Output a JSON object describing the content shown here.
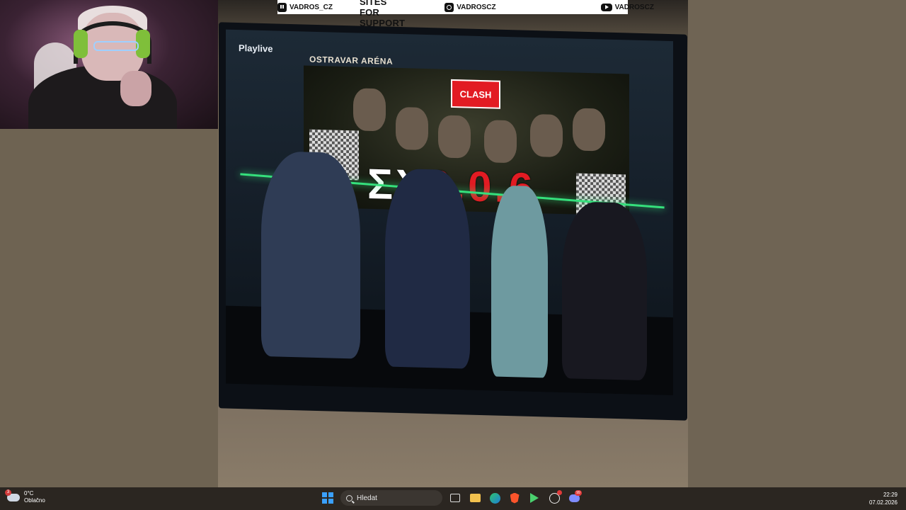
{
  "banner": {
    "twitch_handle": "VADROS_CZ",
    "headline": "SOCIAL SITES FOR SUPPORT",
    "instagram_handle": "VADROSCZ",
    "youtube_handle": "VADROSCZ"
  },
  "tv": {
    "channel_logo": "Playlive",
    "venue": "OSTRAVAR ARÉNA",
    "brand": "CLASH",
    "event_title_prefix": "ƩX",
    "event_title_suffix": "6.0.6"
  },
  "taskbar": {
    "weather_badge": "3",
    "temperature": "0°C",
    "condition": "Oblačno",
    "search_placeholder": "Hledat",
    "time": "22:29",
    "date": "07.02.2026",
    "icons": [
      "windows-start",
      "file-explorer",
      "folder",
      "edge",
      "brave",
      "gamepad",
      "chatgpt",
      "discord"
    ],
    "discord_badge": "99"
  },
  "colors": {
    "accent_red": "#e21b23",
    "neon_green": "#35e07c",
    "taskbar_bg": "#2b2621",
    "desktop_bg": "#6f6454"
  }
}
